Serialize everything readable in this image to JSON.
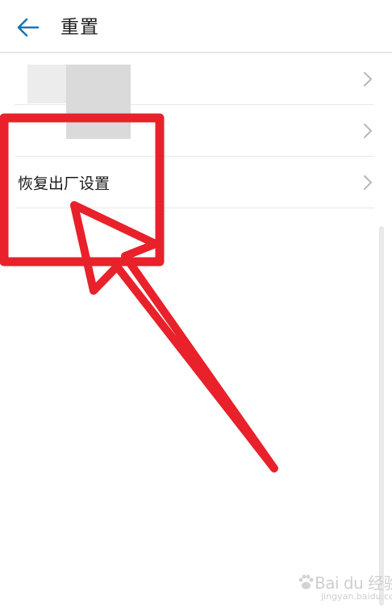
{
  "header": {
    "title": "重置",
    "back_icon": "arrow-left-icon"
  },
  "list": {
    "items": [
      {
        "label": "",
        "chevron_icon": "chevron-right-icon"
      },
      {
        "label": "",
        "chevron_icon": "chevron-right-icon"
      },
      {
        "label": "恢复出厂设置",
        "chevron_icon": "chevron-right-icon"
      }
    ]
  },
  "watermark": {
    "brand": "Bai du 经验",
    "sub": "jingyan.baidu.com"
  },
  "colors": {
    "accent": "#1a73b8",
    "annotation": "#e8212b",
    "text": "#1a1a1a",
    "divider": "#e8e8e8"
  }
}
